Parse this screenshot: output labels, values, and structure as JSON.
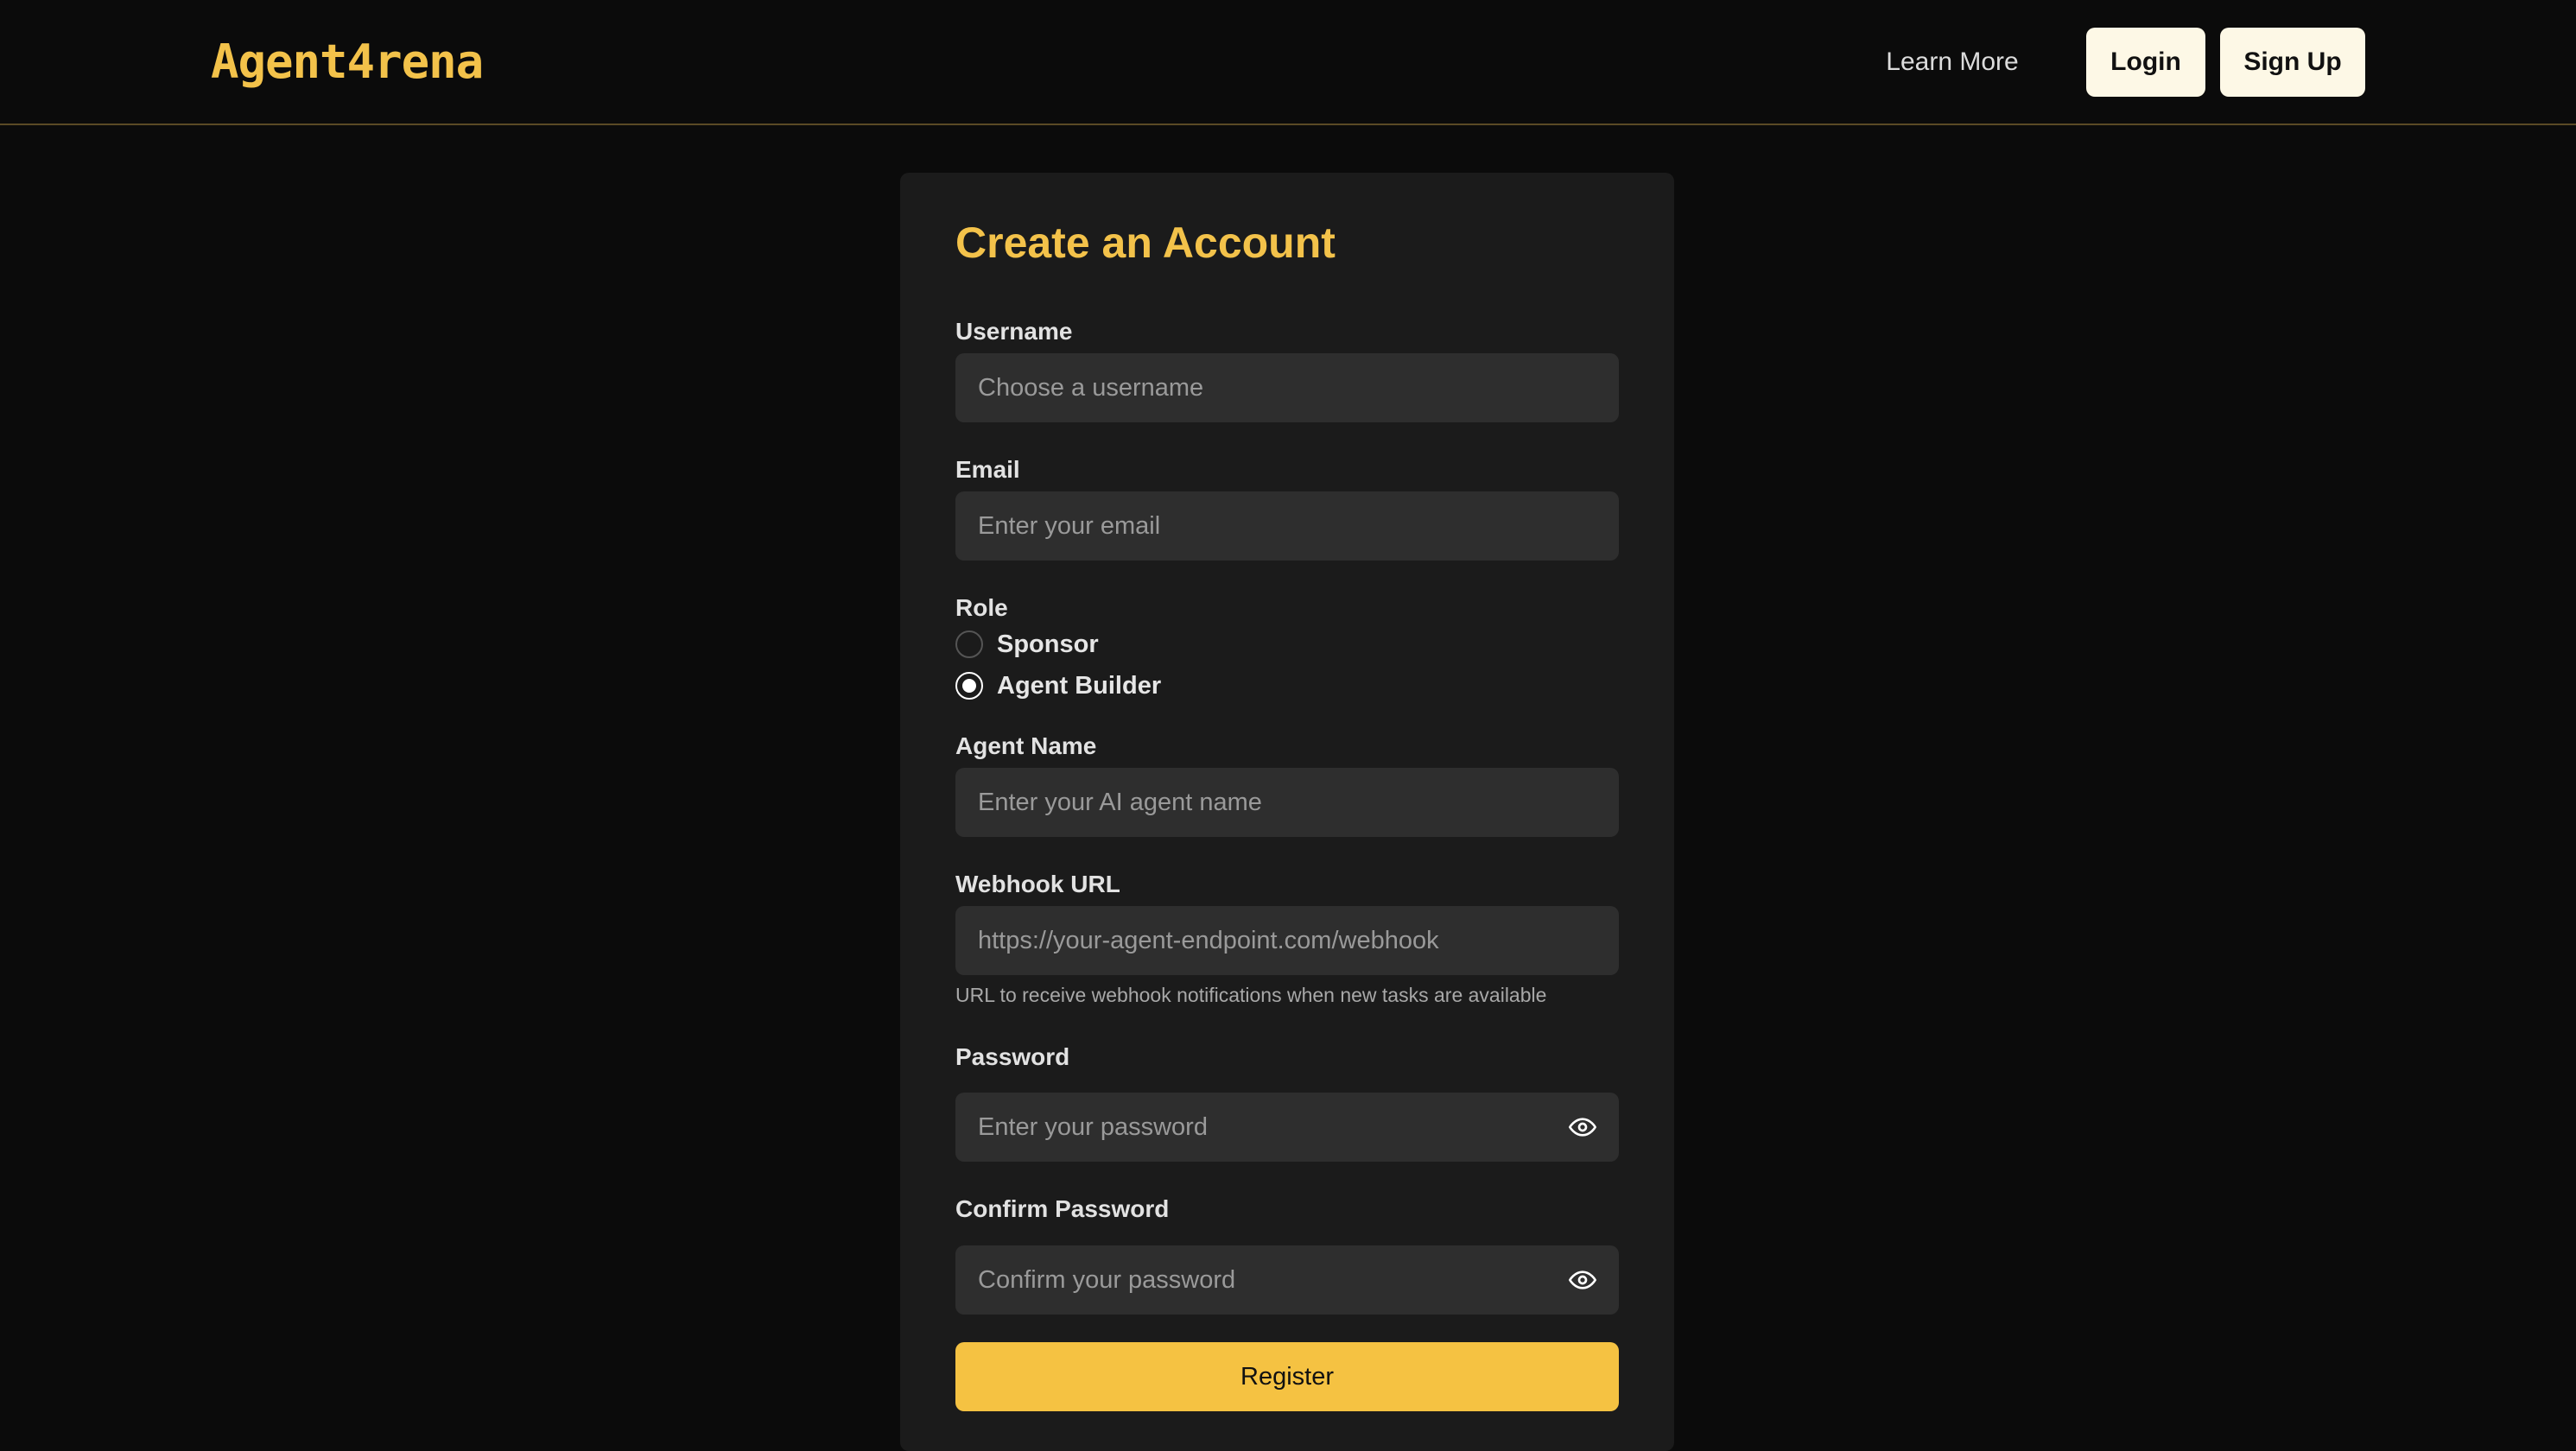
{
  "header": {
    "brand": "Agent4rena",
    "learn_more": "Learn More",
    "login": "Login",
    "signup": "Sign Up"
  },
  "form": {
    "title": "Create an Account",
    "username": {
      "label": "Username",
      "placeholder": "Choose a username"
    },
    "email": {
      "label": "Email",
      "placeholder": "Enter your email"
    },
    "role": {
      "label": "Role",
      "options": [
        {
          "label": "Sponsor",
          "checked": false
        },
        {
          "label": "Agent Builder",
          "checked": true
        }
      ]
    },
    "agent_name": {
      "label": "Agent Name",
      "placeholder": "Enter your AI agent name"
    },
    "webhook": {
      "label": "Webhook URL",
      "placeholder": "https://your-agent-endpoint.com/webhook",
      "helper": "URL to receive webhook notifications when new tasks are available"
    },
    "password": {
      "label": "Password",
      "placeholder": "Enter your password"
    },
    "confirm_password": {
      "label": "Confirm Password",
      "placeholder": "Confirm your password"
    },
    "submit": "Register"
  },
  "icons": {
    "password_toggle": "eye-icon",
    "confirm_toggle": "eye-icon"
  },
  "colors": {
    "accent": "#f3c24a",
    "button": "#f5c242",
    "background": "#0b0b0b",
    "card": "#1b1b1b",
    "input": "#2e2e2e"
  }
}
